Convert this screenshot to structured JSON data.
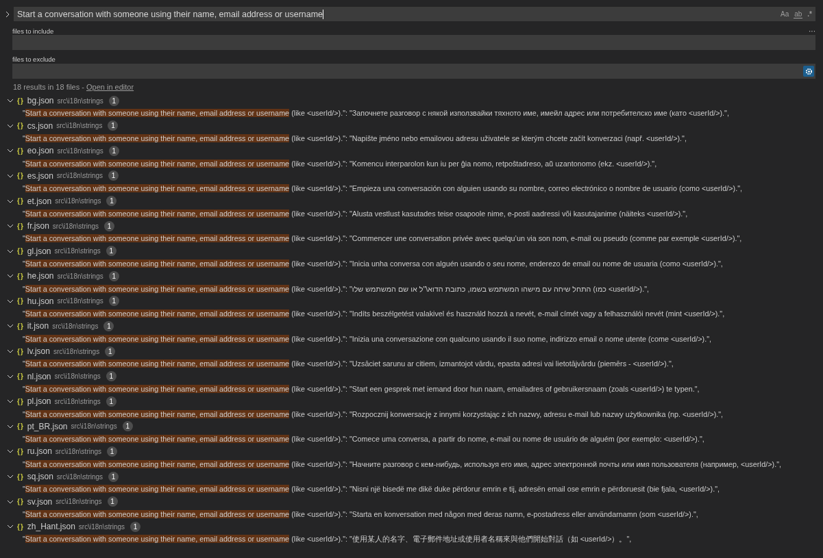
{
  "search": {
    "value": "Start a conversation with someone using their name, email address or username",
    "toggles": [
      {
        "label": "Aa",
        "kind": "case"
      },
      {
        "label": "ab",
        "kind": "word"
      },
      {
        "label": ".*",
        "kind": "regex"
      }
    ]
  },
  "more": "···",
  "include": {
    "label": "files to include"
  },
  "exclude": {
    "label": "files to exclude"
  },
  "summary": {
    "text": "18 results in 18 files - ",
    "link": "Open in editor"
  },
  "results": [
    {
      "file": "bg.json",
      "path": "src\\i18n\\strings",
      "count": "1",
      "expanded": true,
      "icon": "{}",
      "line": {
        "before": "\"",
        "match": "Start a conversation with someone using their name, email address or username",
        "after": " (like <userId/>).\": \"Започнете разговор с някой използвайки тяхното име, имейл адрес или потребителско име (като <userId/>).\","
      }
    },
    {
      "file": "cs.json",
      "path": "src\\i18n\\strings",
      "count": "1",
      "expanded": true,
      "icon": "{}",
      "line": {
        "before": "\"",
        "match": "Start a conversation with someone using their name, email address or username",
        "after": " (like <userId/>).\": \"Napište jméno nebo emailovou adresu uživatele se kterým chcete začít konverzaci (např. <userId/>).\","
      }
    },
    {
      "file": "eo.json",
      "path": "src\\i18n\\strings",
      "count": "1",
      "expanded": true,
      "icon": "{}",
      "line": {
        "before": "\"",
        "match": "Start a conversation with someone using their name, email address or username",
        "after": " (like <userId/>).\": \"Komencu interparolon kun iu per ĝia nomo, retpoŝtadreso, aŭ uzantonomo (ekz. <userId/>).\","
      }
    },
    {
      "file": "es.json",
      "path": "src\\i18n\\strings",
      "count": "1",
      "expanded": true,
      "icon": "{}",
      "line": {
        "before": "\"",
        "match": "Start a conversation with someone using their name, email address or username",
        "after": " (like <userId/>).\": \"Empieza una conversación con alguien usando su nombre, correo electrónico o nombre de usuario (como <userId/>).\","
      }
    },
    {
      "file": "et.json",
      "path": "src\\i18n\\strings",
      "count": "1",
      "expanded": true,
      "icon": "{}",
      "line": {
        "before": "\"",
        "match": "Start a conversation with someone using their name, email address or username",
        "after": " (like <userId/>).\": \"Alusta vestlust kasutades teise osapoole nime, e-posti aadressi või kasutajanime (näiteks <userId/>).\","
      }
    },
    {
      "file": "fr.json",
      "path": "src\\i18n\\strings",
      "count": "1",
      "expanded": true,
      "icon": "{}",
      "line": {
        "before": "\"",
        "match": "Start a conversation with someone using their name, email address or username",
        "after": " (like <userId/>).\": \"Commencer une conversation privée avec quelqu’un via son nom, e-mail ou pseudo (comme par exemple <userId/>).\","
      }
    },
    {
      "file": "gl.json",
      "path": "src\\i18n\\strings",
      "count": "1",
      "expanded": true,
      "icon": "{}",
      "line": {
        "before": "\"",
        "match": "Start a conversation with someone using their name, email address or username",
        "after": " (like <userId/>).\": \"Inicia unha conversa con alguén usando o seu nome, enderezo de email ou nome de usuaria (como <userId/>).\","
      }
    },
    {
      "file": "he.json",
      "path": "src\\i18n\\strings",
      "count": "1",
      "expanded": true,
      "icon": "{}",
      "line": {
        "before": "\"",
        "match": "Start a conversation with someone using their name, email address or username",
        "after": " (like <userId/>).\": \"התחל שיחה עם מישהו המשתמש בשמו, כתובת הדוא\\\"ל או שם המשתמש שלו (כמו <userId/>).\","
      }
    },
    {
      "file": "hu.json",
      "path": "src\\i18n\\strings",
      "count": "1",
      "expanded": true,
      "icon": "{}",
      "line": {
        "before": "\"",
        "match": "Start a conversation with someone using their name, email address or username",
        "after": " (like <userId/>).\": \"Indíts beszélgetést valakivel és használd hozzá a nevét, e-mail címét vagy a felhasználói nevét (mint <userId/>).\","
      }
    },
    {
      "file": "it.json",
      "path": "src\\i18n\\strings",
      "count": "1",
      "expanded": true,
      "icon": "{}",
      "line": {
        "before": "\"",
        "match": "Start a conversation with someone using their name, email address or username",
        "after": " (like <userId/>).\": \"Inizia una conversazione con qualcuno usando il suo nome, indirizzo email o nome utente (come <userId/>).\","
      }
    },
    {
      "file": "lv.json",
      "path": "src\\i18n\\strings",
      "count": "1",
      "expanded": true,
      "icon": "{}",
      "line": {
        "before": "\"",
        "match": "Start a conversation with someone using their name, email address or username",
        "after": " (like <userId/>).\": \"Uzsāciet sarunu ar citiem, izmantojot vārdu, epasta adresi vai lietotājvārdu (piemērs - <userId/>).\","
      }
    },
    {
      "file": "nl.json",
      "path": "src\\i18n\\strings",
      "count": "1",
      "expanded": true,
      "icon": "{}",
      "line": {
        "before": "\"",
        "match": "Start a conversation with someone using their name, email address or username",
        "after": " (like <userId/>).\": \"Start een gesprek met iemand door hun naam, emailadres of gebruikersnaam (zoals <userId/>) te typen.\","
      }
    },
    {
      "file": "pl.json",
      "path": "src\\i18n\\strings",
      "count": "1",
      "expanded": true,
      "icon": "{}",
      "line": {
        "before": "\"",
        "match": "Start a conversation with someone using their name, email address or username",
        "after": " (like <userId/>).\": \"Rozpocznij konwersację z innymi korzystając z ich nazwy, adresu e-mail lub nazwy użytkownika (np. <userId/>).\","
      }
    },
    {
      "file": "pt_BR.json",
      "path": "src\\i18n\\strings",
      "count": "1",
      "expanded": true,
      "icon": "{}",
      "line": {
        "before": "\"",
        "match": "Start a conversation with someone using their name, email address or username",
        "after": " (like <userId/>).\": \"Comece uma conversa, a partir do nome, e-mail ou nome de usuário de alguém (por exemplo: <userId/>).\","
      }
    },
    {
      "file": "ru.json",
      "path": "src\\i18n\\strings",
      "count": "1",
      "expanded": true,
      "icon": "{}",
      "line": {
        "before": "\"",
        "match": "Start a conversation with someone using their name, email address or username",
        "after": " (like <userId/>).\": \"Начните разговор с кем-нибудь, используя его имя, адрес электронной почты или имя пользователя (например, <userId/>).\","
      }
    },
    {
      "file": "sq.json",
      "path": "src\\i18n\\strings",
      "count": "1",
      "expanded": true,
      "icon": "{}",
      "line": {
        "before": "\"",
        "match": "Start a conversation with someone using their name, email address or username",
        "after": " (like <userId/>).\": \"Nisni një bisedë me dikë duke përdorur emrin e tij, adresën email ose emrin e përdoruesit (bie fjala, <userId/>).\","
      }
    },
    {
      "file": "sv.json",
      "path": "src\\i18n\\strings",
      "count": "1",
      "expanded": true,
      "icon": "{}",
      "line": {
        "before": "\"",
        "match": "Start a conversation with someone using their name, email address or username",
        "after": " (like <userId/>).\": \"Starta en konversation med någon med deras namn, e-postadress eller användarnamn (som <userId/>).\","
      }
    },
    {
      "file": "zh_Hant.json",
      "path": "src\\i18n\\strings",
      "count": "1",
      "expanded": true,
      "icon": "{}",
      "line": {
        "before": "\"",
        "match": "Start a conversation with someone using their name, email address or username",
        "after": " (like <userId/>).\": \"使用某人的名字、電子郵件地址或使用者名稱來與他們開始對話（如 <userId/>）。\","
      }
    }
  ]
}
